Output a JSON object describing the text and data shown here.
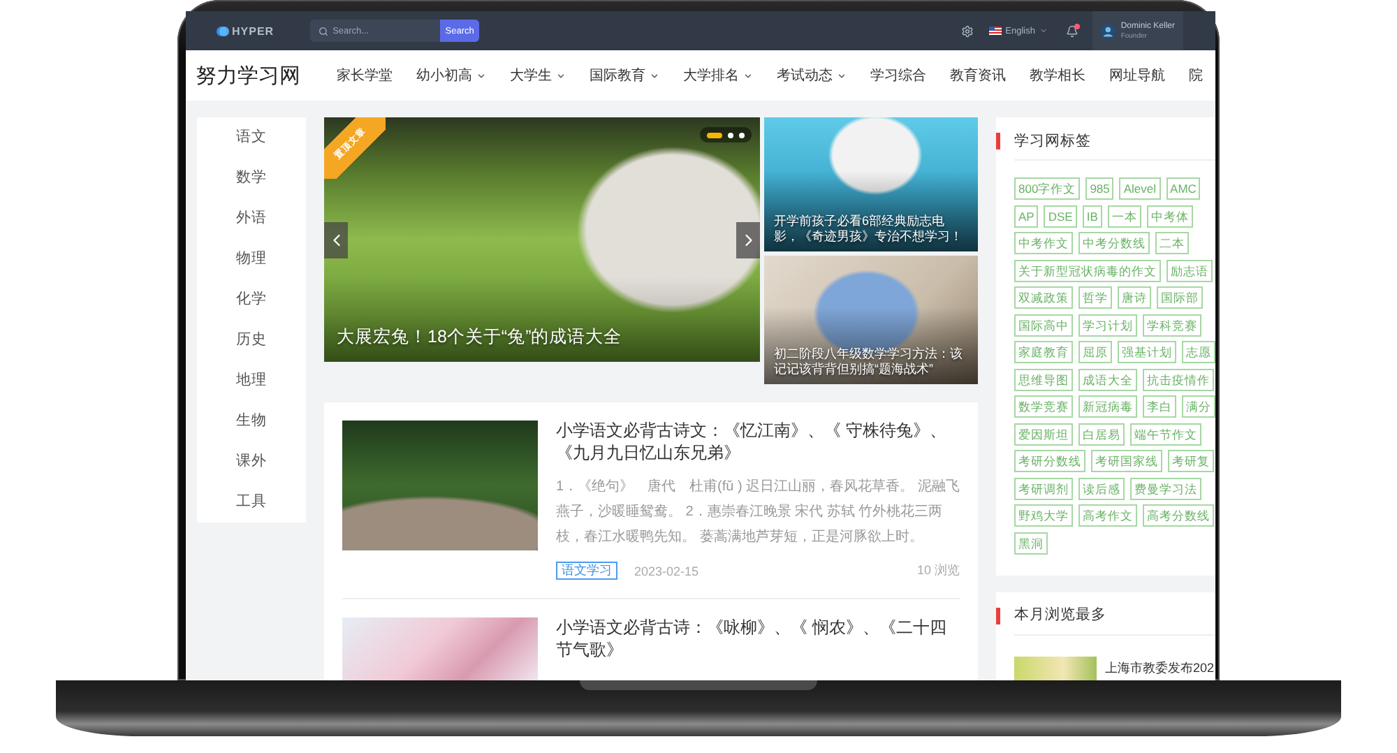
{
  "topbar": {
    "logo": "HYPER",
    "search": {
      "placeholder": "Search...",
      "button": "Search"
    },
    "language": "English",
    "has_unread_notifications": true,
    "user": {
      "name": "Dominic Keller",
      "role": "Founder"
    }
  },
  "site": {
    "logo": "努力学习网",
    "nav": [
      {
        "label": "家长学堂",
        "dropdown": false
      },
      {
        "label": "幼小初高",
        "dropdown": true
      },
      {
        "label": "大学生",
        "dropdown": true
      },
      {
        "label": "国际教育",
        "dropdown": true
      },
      {
        "label": "大学排名",
        "dropdown": true
      },
      {
        "label": "考试动态",
        "dropdown": true
      },
      {
        "label": "学习综合",
        "dropdown": false
      },
      {
        "label": "教育资讯",
        "dropdown": false
      },
      {
        "label": "教学相长",
        "dropdown": false
      },
      {
        "label": "网址导航",
        "dropdown": false
      },
      {
        "label": "院",
        "dropdown": false
      }
    ]
  },
  "subjects": [
    "语文",
    "数学",
    "外语",
    "物理",
    "化学",
    "历史",
    "地理",
    "生物",
    "课外",
    "工具"
  ],
  "carousel": {
    "badge": "置顶文章",
    "caption": "大展宏兔！18个关于“兔”的成语大全",
    "indicators": [
      {
        "selected": true
      },
      {
        "selected": false
      },
      {
        "selected": false
      }
    ]
  },
  "features": [
    {
      "caption": "开学前孩子必看6部经典励志电影，《奇迹男孩》专治不想学习！"
    },
    {
      "caption": "初二阶段八年级数学学习方法：该记记该背背但别搞“题海战术”"
    }
  ],
  "articles": [
    {
      "title": "小学语文必背古诗文：《忆江南》、《 守株待兔》、《九月九日忆山东兄弟》",
      "excerpt": "1．《绝句》　唐代　杜甫(fǔ ) 迟日江山丽，春风花草香。 泥融飞燕子，沙暖睡鸳鸯。 2．惠崇春江晚景  宋代  苏轼 竹外桃花三两枝，春江水暖鸭先知。 蒌蒿满地芦芽短，正是河豚欲上时。",
      "tag": "语文学习",
      "date": "2023-02-15",
      "views": "10 浏览"
    },
    {
      "title": "小学语文必背古诗：《咏柳》、《 悯农》、《二十四节气歌》"
    }
  ],
  "tag_cloud": {
    "title": "学习网标签",
    "tags": [
      "800字作文",
      "985",
      "Alevel",
      "AMC",
      "AP",
      "DSE",
      "IB",
      "一本",
      "中考体",
      "中考作文",
      "中考分数线",
      "二本",
      "关于新型冠状病毒的作文",
      "励志语",
      "双减政策",
      "哲学",
      "唐诗",
      "国际部",
      "国际高中",
      "学习计划",
      "学科竞赛",
      "家庭教育",
      "屈原",
      "强基计划",
      "志愿",
      "思维导图",
      "成语大全",
      "抗击疫情作",
      "数学竞赛",
      "新冠病毒",
      "李白",
      "满分",
      "爱因斯坦",
      "白居易",
      "端午节作文",
      "考研分数线",
      "考研国家线",
      "考研复",
      "考研调剂",
      "读后感",
      "费曼学习法",
      "野鸡大学",
      "高考作文",
      "高考分数线",
      "黑洞"
    ]
  },
  "most_viewed": {
    "title": "本月浏览最多",
    "items": [
      {
        "title": "上海市教委发布202"
      }
    ]
  }
}
